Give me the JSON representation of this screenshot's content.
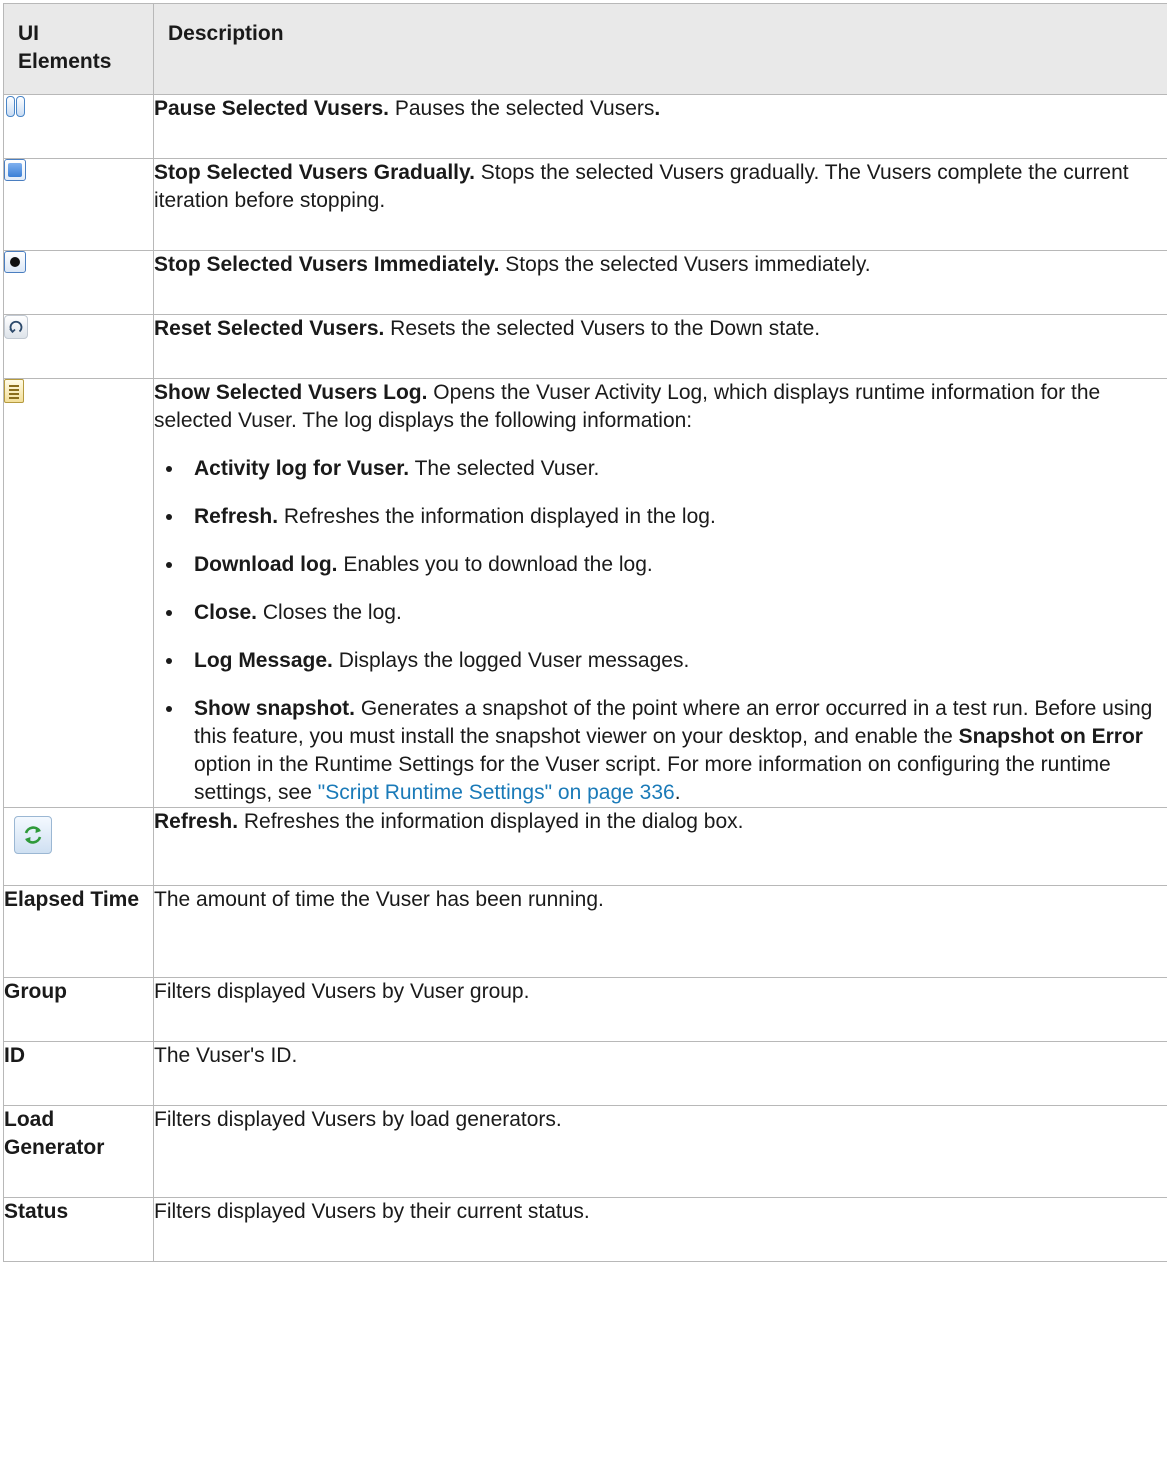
{
  "headers": {
    "ui_elements": "UI\nElements",
    "description": "Description"
  },
  "icon_rows": [
    {
      "icon": "pause-icon",
      "title": "Pause Selected Vusers.",
      "text": " Pauses the selected Vusers",
      "tail": "."
    },
    {
      "icon": "stop-gradually-icon",
      "title": "Stop Selected Vusers Gradually.",
      "text": " Stops the selected Vusers gradually. The Vusers complete the current iteration before stopping."
    },
    {
      "icon": "stop-immediately-icon",
      "title": "Stop Selected Vusers Immediately.",
      "text": " Stops the selected Vusers immediately."
    },
    {
      "icon": "reset-icon",
      "title": "Reset Selected Vusers.",
      "text": " Resets the selected Vusers to the Down state."
    }
  ],
  "log_row": {
    "icon": "log-icon",
    "title": "Show Selected Vusers Log.",
    "text": " Opens the Vuser Activity Log, which displays runtime information for the selected Vuser. The log displays the following information:",
    "items": [
      {
        "title": "Activity log for Vuser.",
        "text": " The selected Vuser."
      },
      {
        "title": "Refresh.",
        "text": " Refreshes the information displayed in the log."
      },
      {
        "title": "Download log.",
        "text": " Enables you to download the log."
      },
      {
        "title": "Close.",
        "text": " Closes the log."
      },
      {
        "title": "Log Message.",
        "text": " Displays the logged Vuser messages."
      }
    ],
    "snapshot": {
      "title": "Show snapshot.",
      "text1": " Generates a snapshot of the point where an error occurred in a test run. Before using this feature, you must install the snapshot viewer on your desktop, and enable the ",
      "option": "Snapshot on Error",
      "text2": " option in the Runtime Settings for the Vuser script. For more information on configuring the runtime settings, see ",
      "link": "\"Script Runtime Settings\" on page 336",
      "text3": "."
    }
  },
  "refresh_row": {
    "icon": "refresh-icon",
    "title": "Refresh.",
    "text": " Refreshes the information displayed in the dialog box."
  },
  "field_rows": [
    {
      "label": "Elapsed Time",
      "text": "The amount of time the Vuser has been running."
    },
    {
      "label": "Group",
      "text": "Filters displayed Vusers by Vuser group."
    },
    {
      "label": "ID",
      "text": "The Vuser's ID."
    },
    {
      "label": "Load Generator",
      "text": "Filters displayed Vusers by load generators."
    },
    {
      "label": "Status",
      "text": "Filters displayed Vusers by their current status."
    }
  ],
  "colors": {
    "header_bg": "#e9e9e9",
    "border": "#b8b8b8",
    "link": "#1a7ab8"
  }
}
